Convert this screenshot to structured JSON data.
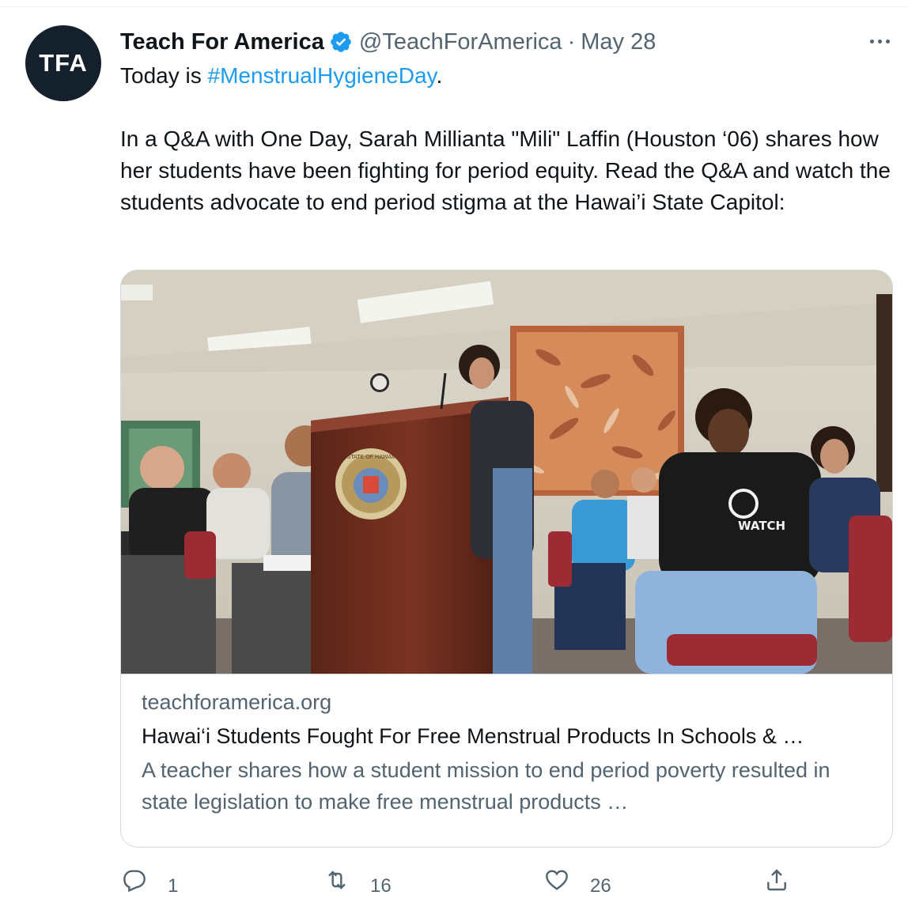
{
  "tweet": {
    "avatar_text": "TFA",
    "author_name": "Teach For America",
    "handle": "@TeachForAmerica",
    "separator": "·",
    "date": "May 28",
    "text_prefix": "Today is ",
    "hashtag": "#MenstrualHygieneDay",
    "text_suffix": ".",
    "paragraph": "In a Q&A with One Day, Sarah Millianta \"Mili\" Laffin (Houston ‘06) shares how her students have been fighting for period equity. Read the Q&A and watch the students advocate to end period stigma at the Hawai’i State Capitol:"
  },
  "card": {
    "domain": "teachforamerica.org",
    "title": "Hawai‘i Students Fought For Free Menstrual Products In Schools & …",
    "description": "A teacher shares how a student mission to end period poverty resulted in state legislation to make free menstrual products …",
    "podium_seal_text": "STATE OF HAWAII",
    "shirt_text": "WATCH"
  },
  "actions": {
    "reply_count": "1",
    "retweet_count": "16",
    "like_count": "26"
  },
  "colors": {
    "accent": "#1d9bf0",
    "secondary_text": "#536471",
    "avatar_bg": "#14202b"
  },
  "icons": [
    "verified-badge-icon",
    "more-icon",
    "reply-icon",
    "retweet-icon",
    "like-icon",
    "share-icon"
  ]
}
